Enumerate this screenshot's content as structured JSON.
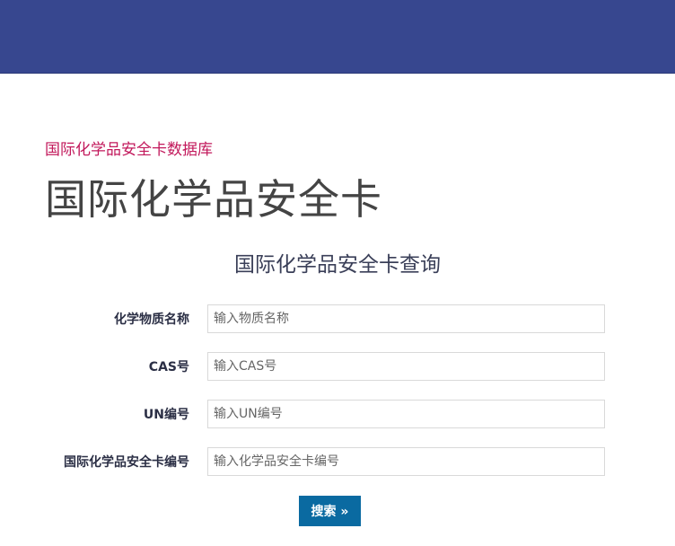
{
  "header": {
    "subtitle": "国际化学品安全卡数据库",
    "title": "国际化学品安全卡"
  },
  "form": {
    "heading": "国际化学品安全卡查询",
    "fields": [
      {
        "label": "化学物质名称",
        "placeholder": "输入物质名称",
        "value": ""
      },
      {
        "label": "CAS号",
        "placeholder": "输入CAS号",
        "value": ""
      },
      {
        "label": "UN编号",
        "placeholder": "输入UN编号",
        "value": ""
      },
      {
        "label": "国际化学品安全卡编号",
        "placeholder": "输入化学品安全卡编号",
        "value": ""
      }
    ],
    "search_button": "搜索 »"
  },
  "colors": {
    "topbar": "#37478f",
    "subtitle": "#c2185b",
    "button": "#0a6aa1"
  }
}
